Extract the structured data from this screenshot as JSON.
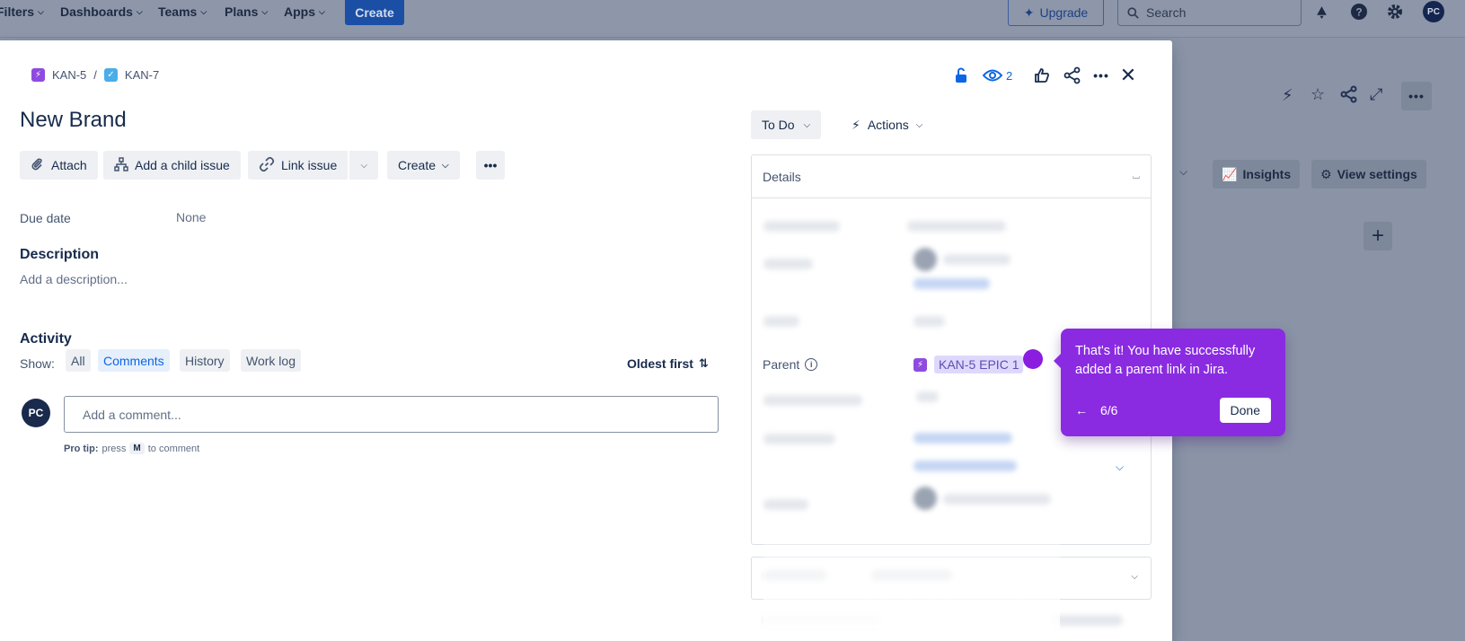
{
  "topnav": {
    "items": [
      {
        "label": "Filters"
      },
      {
        "label": "Dashboards"
      },
      {
        "label": "Teams"
      },
      {
        "label": "Plans"
      },
      {
        "label": "Apps"
      }
    ],
    "create_label": "Create",
    "upgrade_label": "Upgrade",
    "search_placeholder": "Search",
    "avatar_initials": "PC"
  },
  "background": {
    "insights_label": "Insights",
    "view_settings_label": "View settings"
  },
  "issue": {
    "breadcrumb": {
      "parent": "KAN-5",
      "separator": "/",
      "current": "KAN-7"
    },
    "title": "New Brand",
    "watchers_count": "2",
    "toolbar": {
      "attach": "Attach",
      "add_child": "Add a child issue",
      "link_issue": "Link issue",
      "create": "Create"
    },
    "fields": {
      "due_date_label": "Due date",
      "due_date_value": "None"
    },
    "description": {
      "heading": "Description",
      "placeholder": "Add a description..."
    },
    "activity": {
      "heading": "Activity",
      "show_label": "Show:",
      "filters": [
        "All",
        "Comments",
        "History",
        "Work log"
      ],
      "sort_label": "Oldest first",
      "comment_placeholder": "Add a comment...",
      "avatar_initials": "PC",
      "protip_bold": "Pro tip:",
      "protip_pre": "press",
      "protip_key": "M",
      "protip_post": "to comment"
    },
    "status": {
      "label": "To Do"
    },
    "actions_label": "Actions",
    "details": {
      "heading": "Details",
      "parent_label": "Parent",
      "parent_value": "KAN-5 EPIC 1"
    }
  },
  "tour": {
    "text": "That's it! You have successfully added a parent link in Jira.",
    "step": "6/6",
    "done_label": "Done"
  },
  "colors": {
    "accent": "#0c66e4",
    "tour": "#8a2be2",
    "epic": "#8f4be0",
    "task": "#4bade8"
  }
}
